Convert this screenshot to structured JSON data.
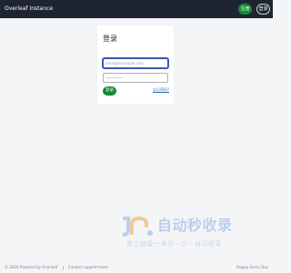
{
  "navbar": {
    "brand": "Overleaf Instance",
    "register_label": "注册",
    "login_label": "登录"
  },
  "login_card": {
    "title": "登录",
    "email_placeholder": "email@example.com",
    "password_placeholder": "••••••••",
    "login_button": "登录",
    "forgot_link": "忘记密码?"
  },
  "watermark": {
    "title": "自动秒收录",
    "subtitle": "做上链接一来访一次一自动收录"
  },
  "footer": {
    "copyright": "© 2024 Powered by Overleaf",
    "contact": "Contact support team",
    "greeting": "Happy Every Day"
  },
  "colors": {
    "navbar_bg": "#1e2530",
    "accent_green": "#138a36",
    "link_blue": "#3a6bbf"
  }
}
